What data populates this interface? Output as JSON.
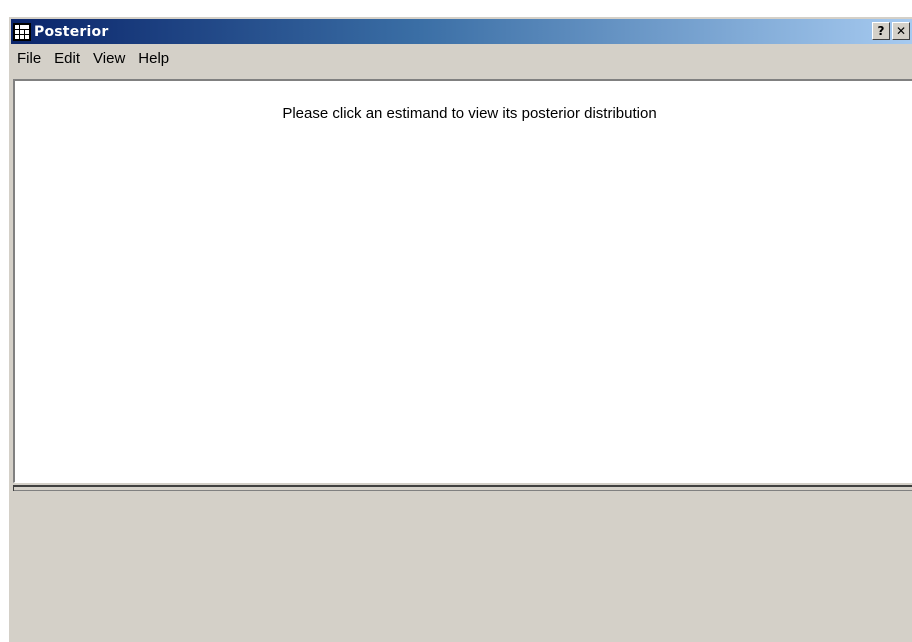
{
  "window": {
    "title": "Posterior",
    "help_button_label": "?",
    "close_button_label": "✕"
  },
  "menu": {
    "items": [
      {
        "label": "File"
      },
      {
        "label": "Edit"
      },
      {
        "label": "View"
      },
      {
        "label": "Help"
      }
    ]
  },
  "content": {
    "message": "Please click an estimand to view its posterior distribution"
  },
  "colors": {
    "titlebar_start": "#0a246a",
    "titlebar_end": "#a6caf0",
    "window_face": "#d4d0c8",
    "content_background": "#ffffff"
  },
  "icons": {
    "window_icon": "grid-window-icon"
  }
}
